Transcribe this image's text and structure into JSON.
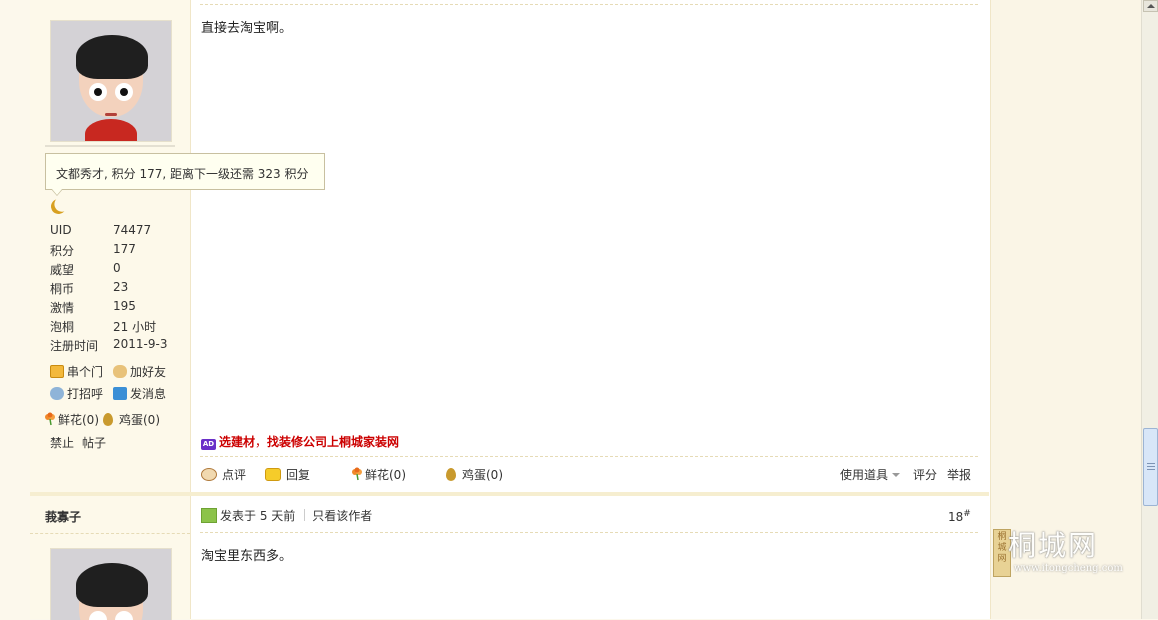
{
  "post": {
    "body": "直接去淘宝啊。",
    "tooltip": "文都秀才, 积分 177, 距离下一级还需 323 积分",
    "stats": [
      {
        "key": "UID",
        "value": "74477"
      },
      {
        "key": "积分",
        "value": "177"
      },
      {
        "key": "威望",
        "value": "0"
      },
      {
        "key": "桐币",
        "value": "23"
      },
      {
        "key": "激情",
        "value": "195"
      },
      {
        "key": "泡桐",
        "value": "21 小时"
      },
      {
        "key": "注册时间",
        "value": "2011-9-3"
      }
    ],
    "user_links": {
      "visit": "串个门",
      "add_friend": "加好友",
      "greet": "打招呼",
      "message": "发消息"
    },
    "flower": "鲜花(0)",
    "egg": "鸡蛋(0)",
    "admin": {
      "ban": "禁止",
      "posts": "帖子"
    },
    "ad": {
      "part1": "选建材",
      "sep": "，",
      "part2": "找装修公司上桐城家装网"
    },
    "actions": {
      "comment": "点评",
      "reply": "回复",
      "flower": "鲜花(0)",
      "egg": "鸡蛋(0)",
      "tools": "使用道具",
      "rate": "评分",
      "report": "举报"
    }
  },
  "post2": {
    "author": "莪寡子",
    "posted": "发表于 5 天前",
    "only_author": "只看该作者",
    "floor": "18",
    "floor_mark": "#",
    "body": "淘宝里东西多。"
  },
  "watermark": {
    "seal": "桐城网",
    "site": "桐城网",
    "url": "www.itongcheng.com"
  },
  "colors": {
    "sidebar_bg": "#fdf9ea",
    "ad_red": "#cc0000",
    "border": "#f0e6c8"
  }
}
